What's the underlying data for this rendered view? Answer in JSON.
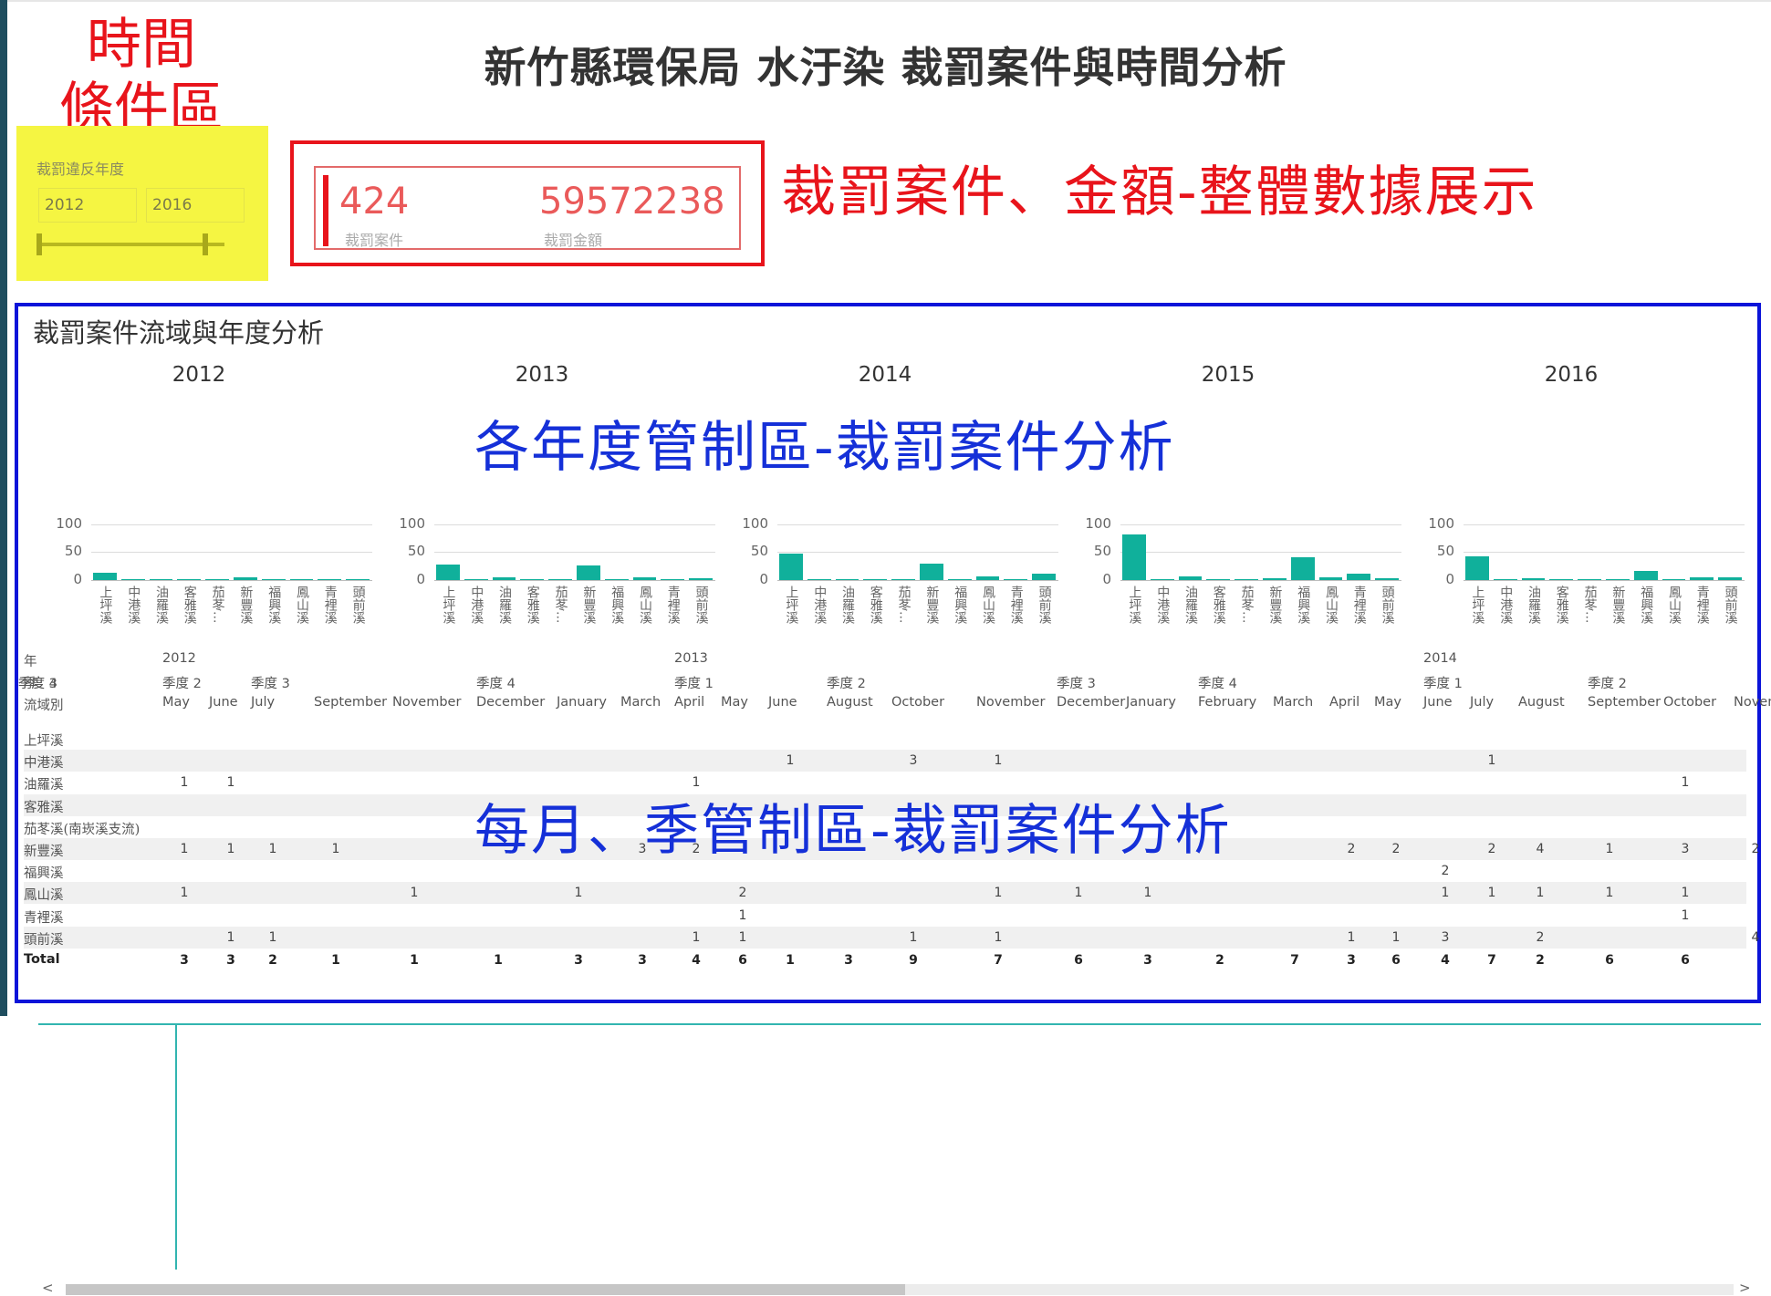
{
  "page": {
    "title": "新竹縣環保局 水汙染 裁罰案件與時間分析",
    "time_label_line1": "時間",
    "time_label_line2": "條件區",
    "kpi_annotation": "裁罰案件、金額-整體數據展示",
    "charts_annotation": "各年度管制區-裁罰案件分析",
    "table_annotation": "每月、季管制區-裁罰案件分析"
  },
  "colors": {
    "bar": "#10b09b",
    "annotation_red": "#e8141b",
    "annotation_blue": "#1530d8",
    "slicer_bg": "#f5f542",
    "table_accent": "#32b5b0"
  },
  "slicer": {
    "title": "裁罰違反年度",
    "start": "2012",
    "end": "2016"
  },
  "kpi": {
    "cases_value": "424",
    "cases_label": "裁罰案件",
    "amount_value": "59572238",
    "amount_label": "裁罰金額"
  },
  "panel": {
    "title": "裁罰案件流域與年度分析"
  },
  "chart_data": {
    "type": "bar",
    "categories": [
      "上坪溪",
      "中港溪",
      "油羅溪",
      "客雅溪",
      "茄苳...",
      "新豐溪",
      "福興溪",
      "鳳山溪",
      "青裡溪",
      "頭前溪"
    ],
    "ylim": [
      0,
      100
    ],
    "yticks": [
      "0",
      "50",
      "100"
    ],
    "years": [
      {
        "year": "2012",
        "values": [
          13,
          1,
          2,
          0,
          1,
          5,
          1,
          2,
          0,
          2
        ]
      },
      {
        "year": "2013",
        "values": [
          28,
          1,
          5,
          1,
          1,
          26,
          1,
          5,
          2,
          4
        ]
      },
      {
        "year": "2014",
        "values": [
          47,
          1,
          1,
          1,
          1,
          29,
          1,
          7,
          2,
          11
        ]
      },
      {
        "year": "2015",
        "values": [
          82,
          1,
          7,
          2,
          1,
          3,
          40,
          5,
          11,
          4
        ]
      },
      {
        "year": "2016",
        "values": [
          42,
          1,
          3,
          1,
          1,
          1,
          16,
          1,
          5,
          5
        ]
      }
    ]
  },
  "table": {
    "row_headers": {
      "year": "年",
      "quarter": "季",
      "basin": "流域別"
    },
    "years": [
      {
        "label": "2012",
        "col": 0
      },
      {
        "label": "2013",
        "col": 8
      },
      {
        "label": "2014",
        "col": 20
      }
    ],
    "quarters": [
      {
        "label": "季度 2",
        "col": 0
      },
      {
        "label": "季度 3",
        "col": 2
      },
      {
        "label": "季度 4",
        "col": 5
      },
      {
        "label": "季度 1",
        "col": 8
      },
      {
        "label": "季度 2",
        "col": 11
      },
      {
        "label": "季度 3",
        "col": 14
      },
      {
        "label": "季度 4",
        "col": 16
      },
      {
        "label": "季度 1",
        "col": 20
      },
      {
        "label": "季度 2",
        "col": 23
      },
      {
        "label": "季度 3",
        "col": 26
      },
      {
        "label": "季度 4",
        "col": 29
      }
    ],
    "months": [
      "May",
      "June",
      "July",
      "September",
      "November",
      "December",
      "January",
      "March",
      "April",
      "May",
      "June",
      "August",
      "October",
      "November",
      "December",
      "January",
      "February",
      "March",
      "April",
      "May",
      "June",
      "July",
      "August",
      "September",
      "October",
      "Novemb"
    ],
    "rows": [
      {
        "label": "上坪溪",
        "cells": []
      },
      {
        "label": "中港溪",
        "cells": [
          [
            10,
            "1"
          ],
          [
            12,
            "3"
          ],
          [
            13,
            "1"
          ],
          [
            21,
            "1"
          ]
        ]
      },
      {
        "label": "油羅溪",
        "cells": [
          [
            0,
            "1"
          ],
          [
            1,
            "1"
          ],
          [
            8,
            "1"
          ],
          [
            24,
            "1"
          ]
        ]
      },
      {
        "label": "客雅溪",
        "cells": []
      },
      {
        "label": "茄苳溪(南崁溪支流)",
        "cells": []
      },
      {
        "label": "新豐溪",
        "cells": [
          [
            0,
            "1"
          ],
          [
            1,
            "1"
          ],
          [
            2,
            "1"
          ],
          [
            3,
            "1"
          ],
          [
            7,
            "3"
          ],
          [
            8,
            "2"
          ],
          [
            18,
            "2"
          ],
          [
            19,
            "2"
          ],
          [
            21,
            "2"
          ],
          [
            22,
            "4"
          ],
          [
            23,
            "1"
          ],
          [
            24,
            "3"
          ],
          [
            25,
            "2"
          ]
        ]
      },
      {
        "label": "福興溪",
        "cells": [
          [
            20,
            "2"
          ]
        ]
      },
      {
        "label": "鳳山溪",
        "cells": [
          [
            0,
            "1"
          ],
          [
            4,
            "1"
          ],
          [
            6,
            "1"
          ],
          [
            9,
            "2"
          ],
          [
            13,
            "1"
          ],
          [
            14,
            "1"
          ],
          [
            15,
            "1"
          ],
          [
            20,
            "1"
          ],
          [
            21,
            "1"
          ],
          [
            22,
            "1"
          ],
          [
            23,
            "1"
          ],
          [
            24,
            "1"
          ]
        ]
      },
      {
        "label": "青裡溪",
        "cells": [
          [
            9,
            "1"
          ],
          [
            24,
            "1"
          ]
        ]
      },
      {
        "label": "頭前溪",
        "cells": [
          [
            1,
            "1"
          ],
          [
            2,
            "1"
          ],
          [
            8,
            "1"
          ],
          [
            9,
            "1"
          ],
          [
            12,
            "1"
          ],
          [
            13,
            "1"
          ],
          [
            18,
            "1"
          ],
          [
            19,
            "1"
          ],
          [
            20,
            "3"
          ],
          [
            22,
            "2"
          ],
          [
            25,
            "4"
          ]
        ]
      }
    ],
    "total_label": "Total",
    "totals": [
      "3",
      "3",
      "2",
      "1",
      "1",
      "1",
      "3",
      "3",
      "4",
      "6",
      "1",
      "3",
      "9",
      "7",
      "6",
      "3",
      "2",
      "7",
      "3",
      "6",
      "4",
      "7",
      "2",
      "6",
      "6"
    ],
    "scroll_left": "<",
    "scroll_right": ">"
  }
}
